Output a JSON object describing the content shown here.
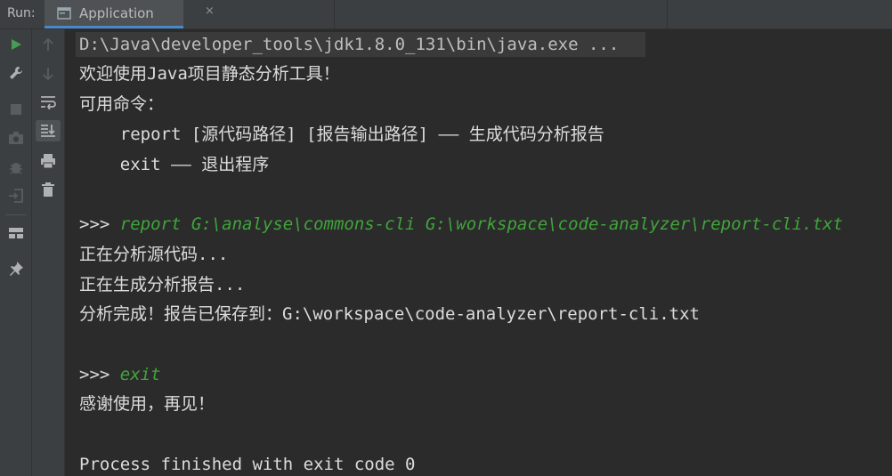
{
  "header": {
    "run_label": "Run:",
    "tab_label": "Application",
    "tab_close": "×"
  },
  "toolbar": {
    "left": [
      "run-icon",
      "wrench-icon",
      "stop-icon",
      "camera-icon",
      "debug-settings-icon",
      "login-icon",
      "layout-icon",
      "pin-icon"
    ],
    "right": [
      "up-arrow-icon",
      "down-arrow-icon",
      "soft-wrap-icon",
      "scroll-to-end-icon",
      "print-icon",
      "trash-icon"
    ]
  },
  "console": {
    "lines": [
      {
        "text": "D:\\Java\\developer_tools\\jdk1.8.0_131\\bin\\java.exe ..."
      },
      {
        "text": "欢迎使用Java项目静态分析工具！"
      },
      {
        "text": "可用命令："
      },
      {
        "text": "    report [源代码路径] [报告输出路径] —— 生成代码分析报告"
      },
      {
        "text": "    exit —— 退出程序"
      },
      {
        "prompt": ">>> ",
        "command": "report G:\\analyse\\commons-cli G:\\workspace\\code-analyzer\\report-cli.txt"
      },
      {
        "text": "正在分析源代码..."
      },
      {
        "text": "正在生成分析报告..."
      },
      {
        "text": "分析完成！报告已保存到：G:\\workspace\\code-analyzer\\report-cli.txt"
      },
      {
        "prompt": ">>> ",
        "command": "exit"
      },
      {
        "text": "感谢使用，再见！"
      },
      {
        "text": "Process finished with exit code 0"
      }
    ]
  },
  "colors": {
    "background": "#2b2b2b",
    "panel": "#3c3f41",
    "text": "#dcdcdc",
    "command": "#3fa53a",
    "accent": "#4a88c7",
    "run_green": "#499c54"
  }
}
